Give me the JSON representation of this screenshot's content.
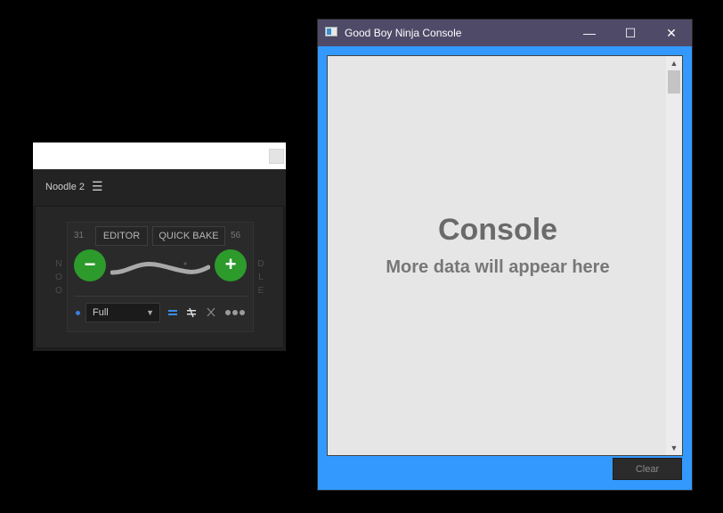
{
  "noodle": {
    "title": "Noodle 2",
    "menu_icon": "☰",
    "left_letters": [
      "N",
      "O",
      "O"
    ],
    "right_letters": [
      "D",
      "L",
      "E"
    ],
    "left_number": "31",
    "right_number": "56",
    "editor_label": "EDITOR",
    "quick_bake_label": "QUICK BAKE",
    "minus_label": "−",
    "plus_label": "+",
    "select_value": "Full",
    "icons": [
      "minus-circle-icon",
      "plus-circle-icon",
      "equals-icon",
      "not-equal-icon",
      "close-icon",
      "more-icon"
    ],
    "accent_green": "#2d9a2c",
    "accent_blue": "#3a7ee0"
  },
  "console": {
    "window_title": "Good Boy Ninja Console",
    "controls": {
      "minimize": "—",
      "maximize": "☐",
      "close": "✕"
    },
    "heading": "Console",
    "subheading": "More data will appear here",
    "clear_label": "Clear",
    "accent_blue": "#3399ff",
    "titlebar_color": "#4e4a67"
  }
}
